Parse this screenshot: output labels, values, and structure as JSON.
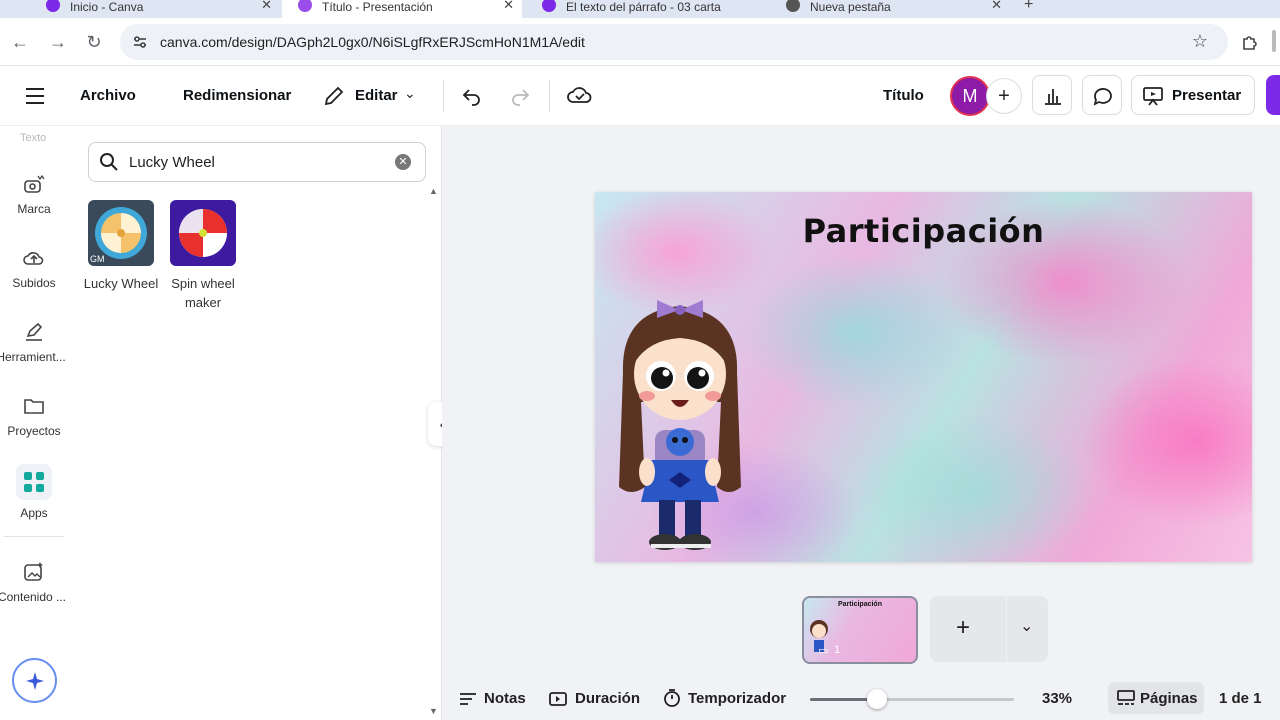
{
  "browser": {
    "tabs": [
      {
        "title": "Inicio - Canva",
        "active": false
      },
      {
        "title": "Título - Presentación",
        "active": true
      },
      {
        "title": "El texto del párrafo - 03 carta",
        "active": false
      },
      {
        "title": "Nueva pestaña",
        "active": false
      }
    ],
    "url": "canva.com/design/DAGph2L0gx0/N6iSLgfRxERJScmHoN1M1A/edit"
  },
  "toolbar": {
    "archivo": "Archivo",
    "redimensionar": "Redimensionar",
    "editar": "Editar",
    "titulo": "Título",
    "avatar_letter": "M",
    "presentar": "Presentar"
  },
  "rail": {
    "top_partial": "Texto",
    "items": [
      {
        "label": "Marca",
        "icon": "brand-crown-icon"
      },
      {
        "label": "Subidos",
        "icon": "cloud-upload-icon"
      },
      {
        "label": "Herramient...",
        "icon": "pen-tool-icon"
      },
      {
        "label": "Proyectos",
        "icon": "folder-icon"
      },
      {
        "label": "Apps",
        "icon": "apps-grid-icon"
      },
      {
        "label": "Contenido ...",
        "icon": "magic-media-icon"
      }
    ]
  },
  "panel": {
    "search_value": "Lucky Wheel",
    "results": [
      {
        "label": "Lucky Wheel"
      },
      {
        "label": "Spin wheel maker"
      }
    ]
  },
  "slide": {
    "title": "Participación"
  },
  "pages": {
    "thumb_title": "Participación",
    "thumb_comment_count": "1"
  },
  "bottombar": {
    "notas": "Notas",
    "duracion": "Duración",
    "temporizador": "Temporizador",
    "zoom": "33%",
    "zoom_fraction": 0.33,
    "paginas": "Páginas",
    "page_count": "1 de 1"
  },
  "colors": {
    "accent_purple": "#7d2ae8",
    "avatar_bg": "#8e1aa8"
  }
}
